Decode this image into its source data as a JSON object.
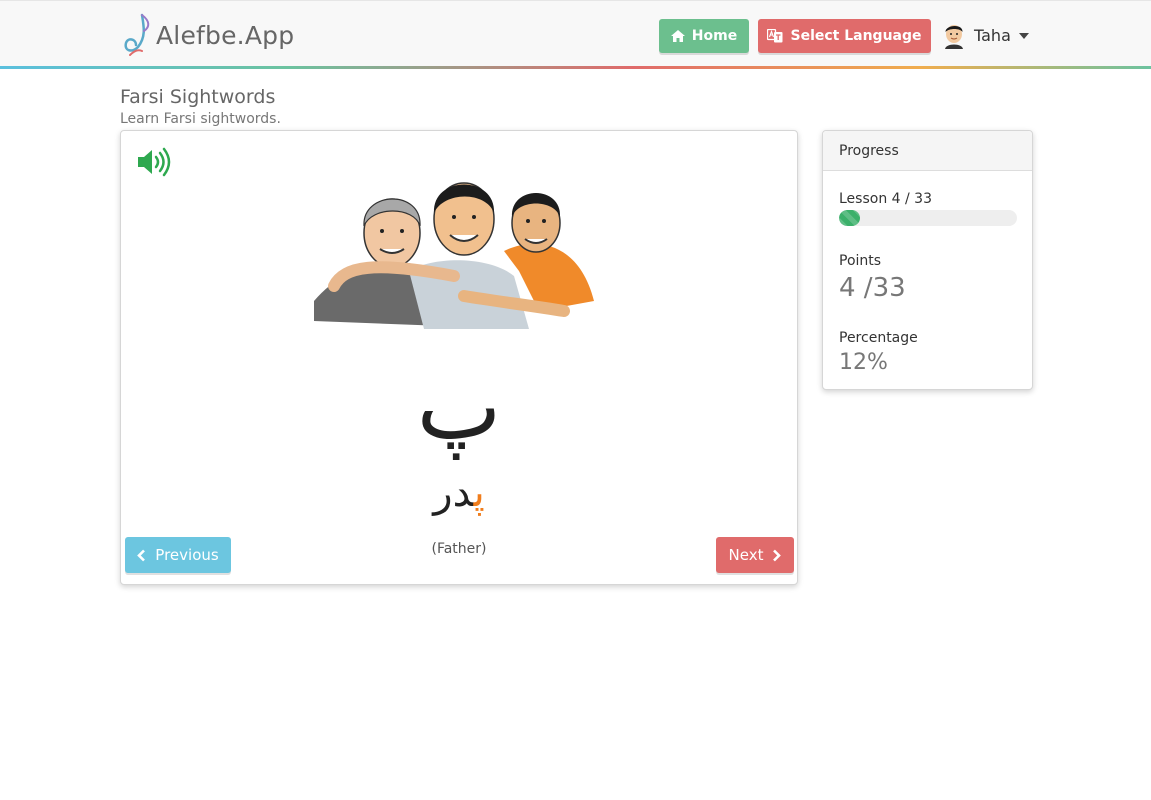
{
  "navbar": {
    "brand": "Alefbe.App",
    "home_label": "Home",
    "select_language_label": "Select Language",
    "user_name": "Taha"
  },
  "header": {
    "title": "Farsi Sightwords",
    "subtitle": "Learn Farsi sightwords."
  },
  "lesson_card": {
    "letter": "پ",
    "word_highlight": "پ",
    "word_rest": "در",
    "translation": "(Father)",
    "previous_label": "Previous",
    "next_label": "Next",
    "illustration_icon": "family-illustration",
    "audio_icon": "speaker-icon"
  },
  "progress": {
    "title": "Progress",
    "lesson_text": "Lesson 4 / 33",
    "lesson_fraction": 0.12,
    "points_label": "Points",
    "points_value": "4 /33",
    "percentage_label": "Percentage",
    "percentage_value": "12%"
  },
  "colors": {
    "home": "#6cbf8e",
    "select_language": "#e06b6b",
    "previous": "#6cc6e0",
    "next": "#e06b6b",
    "progress_bar": "#3bb06a",
    "letter_highlight": "#f07d1c"
  }
}
